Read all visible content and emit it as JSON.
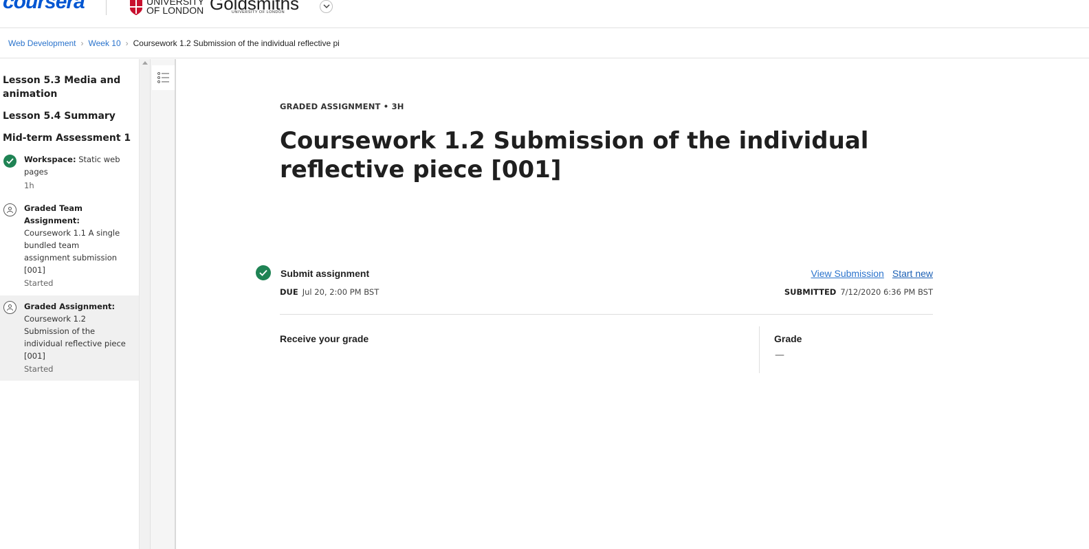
{
  "header": {
    "logo": "coursera",
    "partner_1_line1": "UNIVERSITY",
    "partner_1_line2": "OF LONDON",
    "partner_2": "Goldsmiths",
    "partner_2_sub": "UNIVERSITY OF LONDON"
  },
  "breadcrumb": {
    "items": [
      "Web Development",
      "Week 10"
    ],
    "current": "Coursework 1.2 Submission of the individual reflective pi"
  },
  "sidebar": {
    "sections": [
      "Lesson 5.3 Media and animation",
      "Lesson 5.4 Summary",
      "Mid-term Assessment 1"
    ],
    "items": [
      {
        "type": "Workspace:",
        "title": "Static web pages",
        "meta": "1h",
        "status_icon": "check-icon"
      },
      {
        "type": "Graded Team Assignment:",
        "title": "Coursework 1.1 A single bundled team assignment submission [001]",
        "meta": "Started",
        "status_icon": "assignment-icon"
      },
      {
        "type": "Graded Assignment:",
        "title": "Coursework 1.2 Submission of the individual reflective piece [001]",
        "meta": "Started",
        "status_icon": "assignment-icon"
      }
    ]
  },
  "main": {
    "kicker": "GRADED ASSIGNMENT • 3H",
    "title": "Coursework 1.2 Submission of the individual reflective piece [001]",
    "submit_label": "Submit assignment",
    "due_label": "DUE",
    "due_value": "Jul 20, 2:00 PM BST",
    "view_submission": "View Submission",
    "start_new": "Start new",
    "submitted_label": "SUBMITTED",
    "submitted_value": "7/12/2020 6:36 PM BST",
    "receive_label": "Receive your grade",
    "grade_label": "Grade",
    "grade_value": "—"
  },
  "colors": {
    "accent": "#2a73cc",
    "success": "#1f8354",
    "brand": "#0056d2"
  }
}
